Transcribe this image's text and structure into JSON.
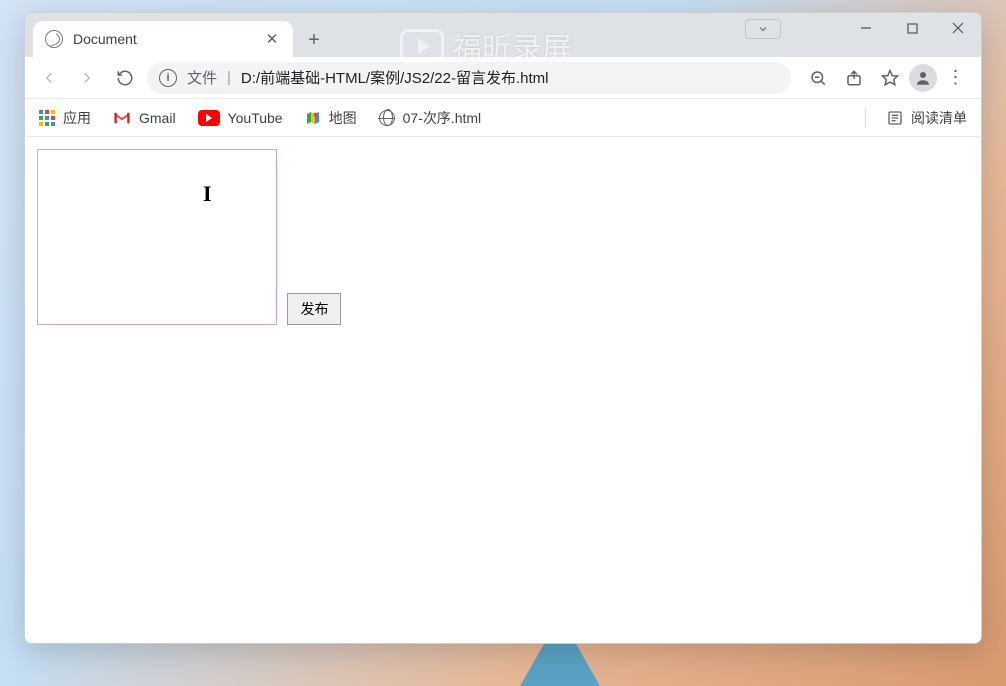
{
  "tab": {
    "title": "Document"
  },
  "addressbar": {
    "file_label": "文件",
    "url": "D:/前端基础-HTML/案例/JS2/22-留言发布.html"
  },
  "bookmarks": {
    "apps": "应用",
    "gmail": "Gmail",
    "youtube": "YouTube",
    "maps": "地图",
    "local": "07-次序.html",
    "readlist": "阅读清单"
  },
  "page": {
    "textarea_value": "",
    "publish_label": "发布"
  },
  "watermark": {
    "text": "福昕录屏"
  }
}
